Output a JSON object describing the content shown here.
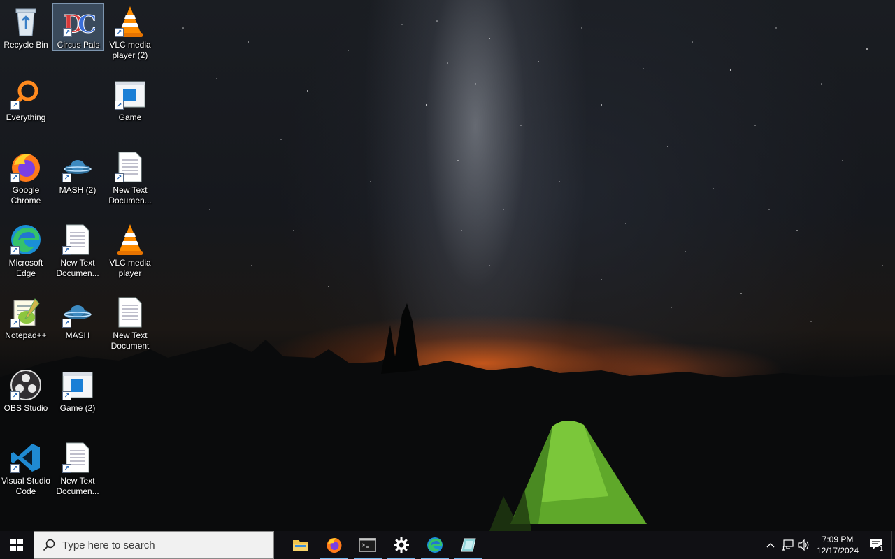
{
  "desktop": {
    "icons": [
      {
        "label": "Recycle Bin",
        "icon": "recycle-bin-icon"
      },
      {
        "label": "Circus Pals",
        "icon": "circus-pals-icon"
      },
      {
        "label": "VLC media player (2)",
        "icon": "vlc-icon"
      },
      {
        "label": "Everything",
        "icon": "everything-search-icon"
      },
      {
        "label": "Game",
        "icon": "game-window-icon"
      },
      {
        "label": "Google Chrome",
        "icon": "firefox-icon"
      },
      {
        "label": "MASH (2)",
        "icon": "mash-icon"
      },
      {
        "label": "New Text Documen...",
        "icon": "text-document-icon"
      },
      {
        "label": "Microsoft Edge",
        "icon": "edge-icon"
      },
      {
        "label": "New Text Documen...",
        "icon": "text-document-icon"
      },
      {
        "label": "VLC media player",
        "icon": "vlc-icon"
      },
      {
        "label": "Notepad++",
        "icon": "notepad-plus-plus-icon"
      },
      {
        "label": "MASH",
        "icon": "mash-icon"
      },
      {
        "label": "New Text Document",
        "icon": "text-document-icon"
      },
      {
        "label": "OBS Studio",
        "icon": "obs-icon"
      },
      {
        "label": "Game (2)",
        "icon": "game-window-icon"
      },
      {
        "label": "Visual Studio Code",
        "icon": "vscode-icon"
      },
      {
        "label": "New Text Documen...",
        "icon": "text-document-icon"
      }
    ],
    "selected": "Circus Pals"
  },
  "taskbar": {
    "search_placeholder": "Type here to search",
    "apps": [
      {
        "name": "file-explorer",
        "icon": "folder-icon",
        "running": false
      },
      {
        "name": "firefox",
        "icon": "firefox-icon",
        "running": true
      },
      {
        "name": "terminal",
        "icon": "terminal-icon",
        "running": true
      },
      {
        "name": "settings",
        "icon": "gear-icon",
        "running": true
      },
      {
        "name": "edge",
        "icon": "edge-icon",
        "running": true
      },
      {
        "name": "app",
        "icon": "app-icon",
        "running": true
      }
    ],
    "tray": {
      "time": "7:09 PM",
      "date": "12/17/2024",
      "notification_count": "1"
    }
  },
  "colors": {
    "taskbar_bg": "#101014",
    "running_indicator": "#76b9ed",
    "selection": "#78a0c8"
  }
}
